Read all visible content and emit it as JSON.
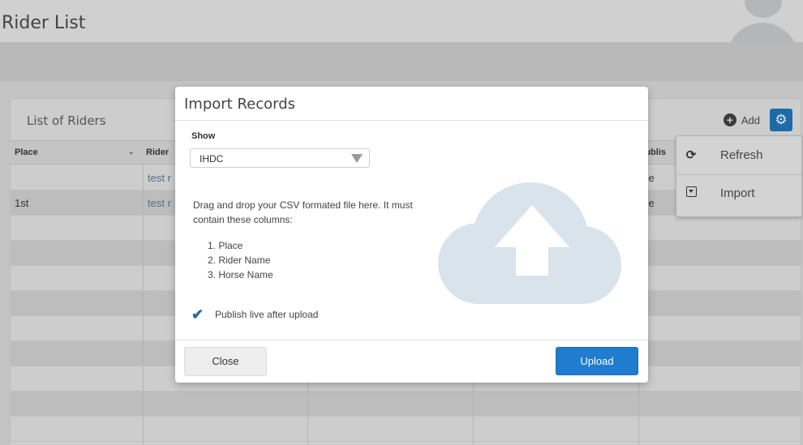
{
  "page": {
    "title": "Rider List"
  },
  "panel": {
    "title": "List of Riders",
    "add_label": "Add"
  },
  "grid": {
    "columns": [
      "Place",
      "Rider",
      "Publis"
    ],
    "rows": [
      {
        "place": "",
        "rider": "test r",
        "published": "rue"
      },
      {
        "place": "1st",
        "rider": "test r",
        "published": "rue"
      }
    ]
  },
  "dropdown": {
    "items": [
      {
        "label": "Refresh",
        "icon": "refresh-icon"
      },
      {
        "label": "Import",
        "icon": "import-icon"
      }
    ]
  },
  "modal": {
    "title": "Import Records",
    "show_label": "Show",
    "show_value": "IHDC",
    "instructions": "Drag and drop your CSV formated file here. It must contain these columns:",
    "columns": [
      "1. Place",
      "2. Rider Name",
      "3. Horse Name"
    ],
    "publish_label": "Publish live after upload",
    "publish_checked": true,
    "close_label": "Close",
    "upload_label": "Upload"
  },
  "colors": {
    "accent": "#1f7ccf",
    "link": "#4d6e8c",
    "cloud": "#d9e3ec"
  }
}
